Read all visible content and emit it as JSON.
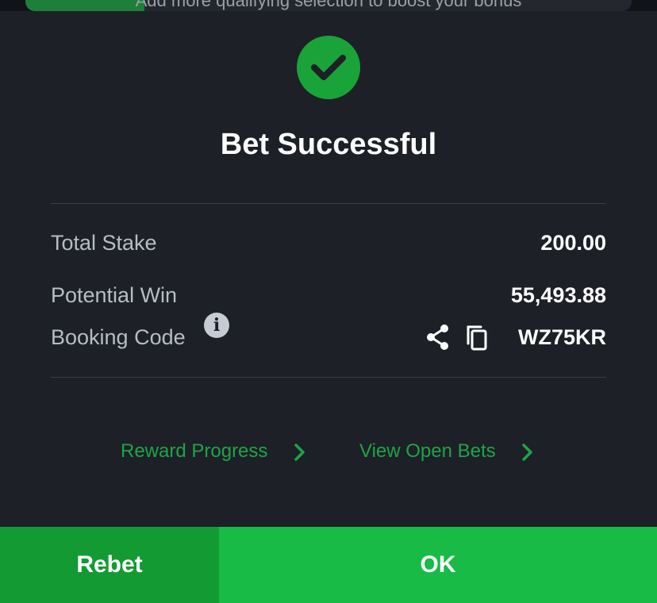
{
  "top_banner": {
    "text": "Add more qualifying selection to boost your bonus"
  },
  "dialog": {
    "status_icon": "check-icon",
    "title": "Bet Successful",
    "rows": [
      {
        "label": "Total Stake",
        "value": "200.00"
      },
      {
        "label": "Potential Win",
        "value": "55,493.88"
      },
      {
        "label": "Booking Code",
        "value": "WZ75KR"
      }
    ],
    "booking_icons": [
      "info-icon",
      "share-icon",
      "copy-icon"
    ],
    "links": [
      {
        "label": "Reward Progress",
        "icon": "chevron-right-icon"
      },
      {
        "label": "View Open Bets",
        "icon": "chevron-right-icon"
      }
    ]
  },
  "footer": {
    "rebet_label": "Rebet",
    "ok_label": "OK"
  },
  "colors": {
    "background": "#1d2027",
    "accent_green": "#17bb46",
    "rebet_green": "#139a33",
    "link_green": "#1fa447",
    "check_circle": "#1aa339"
  }
}
